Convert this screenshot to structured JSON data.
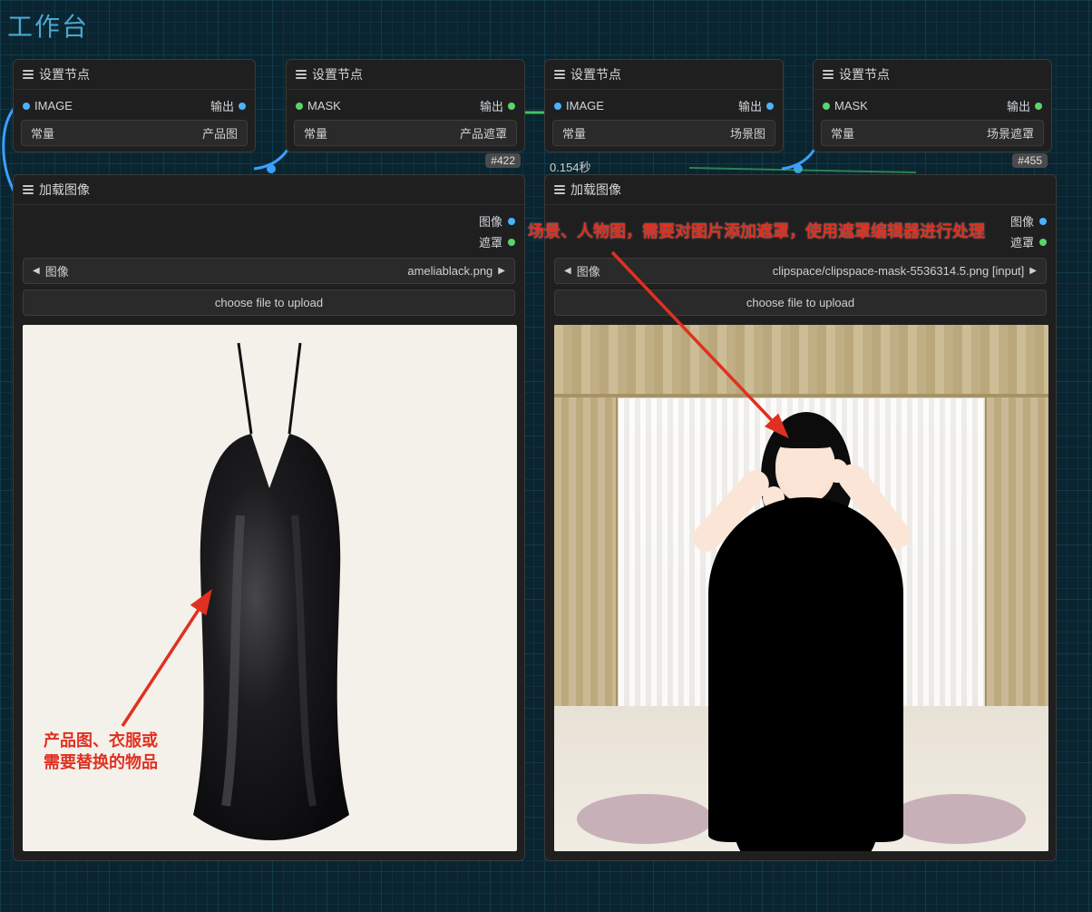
{
  "workspace_title": "工作台",
  "nodes": {
    "set_product_image": {
      "title": "设置节点",
      "port_in": "IMAGE",
      "port_out": "输出",
      "widget_label": "常量",
      "widget_value": "产品图"
    },
    "set_product_mask": {
      "title": "设置节点",
      "port_in": "MASK",
      "port_out": "输出",
      "widget_label": "常量",
      "widget_value": "产品遮罩",
      "badge": "#422"
    },
    "set_scene_image": {
      "title": "设置节点",
      "port_in": "IMAGE",
      "port_out": "输出",
      "widget_label": "常量",
      "widget_value": "场景图",
      "timing": "0.154秒"
    },
    "set_scene_mask": {
      "title": "设置节点",
      "port_in": "MASK",
      "port_out": "输出",
      "widget_label": "常量",
      "widget_value": "场景遮罩",
      "badge": "#455"
    },
    "load_left": {
      "title": "加载图像",
      "out_image": "图像",
      "out_mask": "遮罩",
      "file_label": "图像",
      "file_value": "ameliablack.png",
      "upload_label": "choose file to upload"
    },
    "load_right": {
      "title": "加载图像",
      "out_image": "图像",
      "out_mask": "遮罩",
      "file_label": "图像",
      "file_value": "clipspace/clipspace-mask-5536314.5.png [input]",
      "upload_label": "choose file to upload"
    }
  },
  "annotations": {
    "left": "产品图、衣服或\n需要替换的物品",
    "right": "场景、人物图，需要对图片添加遮罩，使用遮罩编辑器进行处理"
  }
}
